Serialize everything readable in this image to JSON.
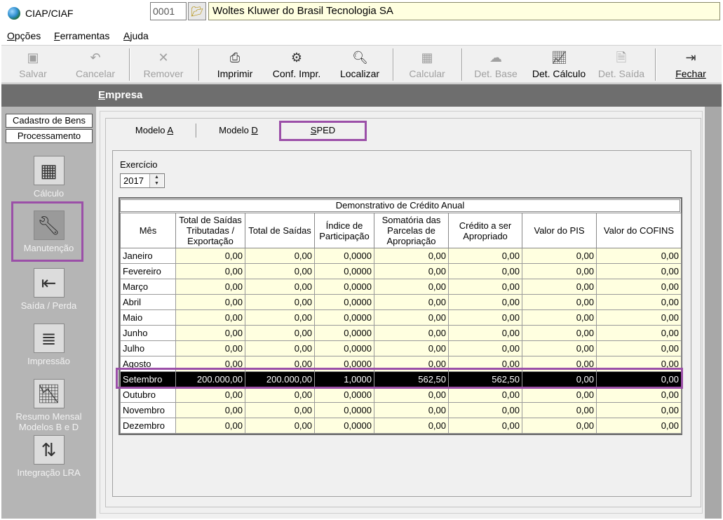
{
  "window": {
    "title": "CIAP/CIAF",
    "minimize": "—",
    "close": "✕"
  },
  "menu": [
    "Opções",
    "Ferramentas",
    "Ajuda"
  ],
  "toolbar": {
    "salvar": "Salvar",
    "cancelar": "Cancelar",
    "remover": "Remover",
    "imprimir": "Imprimir",
    "conf_impr": "Conf. Impr.",
    "localizar": "Localizar",
    "calcular": "Calcular",
    "det_base": "Det. Base",
    "det_calculo": "Det. Cálculo",
    "det_saida": "Det. Saída",
    "fechar": "Fechar"
  },
  "empresa": {
    "label": "Empresa",
    "code": "0001",
    "name": "Woltes Kluwer do Brasil Tecnologia SA"
  },
  "left": {
    "tab1": "Cadastro de Bens",
    "tab2": "Processamento",
    "items": [
      "Cálculo",
      "Manutenção",
      "Saída / Perda",
      "Impressão",
      "Resumo Mensal Modelos B e D",
      "Integração LRA"
    ]
  },
  "tabs": {
    "a_prefix": "Modelo ",
    "a_key": "A",
    "d_prefix": "Modelo ",
    "d_key": "D",
    "sped_key": "S",
    "sped_rest": "PED"
  },
  "exercicio": {
    "label": "Exercício",
    "value": "2017"
  },
  "table": {
    "title": "Demonstrativo de Crédito Anual",
    "headers": [
      "Mês",
      "Total de Saídas Tributadas / Exportação",
      "Total de Saídas",
      "Índice de Participação",
      "Somatória das Parcelas de Apropriação",
      "Crédito a ser Apropriado",
      "Valor do PIS",
      "Valor do COFINS"
    ],
    "rows": [
      [
        "Janeiro",
        "0,00",
        "0,00",
        "0,0000",
        "0,00",
        "0,00",
        "0,00",
        "0,00"
      ],
      [
        "Fevereiro",
        "0,00",
        "0,00",
        "0,0000",
        "0,00",
        "0,00",
        "0,00",
        "0,00"
      ],
      [
        "Março",
        "0,00",
        "0,00",
        "0,0000",
        "0,00",
        "0,00",
        "0,00",
        "0,00"
      ],
      [
        "Abril",
        "0,00",
        "0,00",
        "0,0000",
        "0,00",
        "0,00",
        "0,00",
        "0,00"
      ],
      [
        "Maio",
        "0,00",
        "0,00",
        "0,0000",
        "0,00",
        "0,00",
        "0,00",
        "0,00"
      ],
      [
        "Junho",
        "0,00",
        "0,00",
        "0,0000",
        "0,00",
        "0,00",
        "0,00",
        "0,00"
      ],
      [
        "Julho",
        "0,00",
        "0,00",
        "0,0000",
        "0,00",
        "0,00",
        "0,00",
        "0,00"
      ],
      [
        "Agosto",
        "0,00",
        "0,00",
        "0,0000",
        "0,00",
        "0,00",
        "0,00",
        "0,00"
      ],
      [
        "Setembro",
        "200.000,00",
        "200.000,00",
        "1,0000",
        "562,50",
        "562,50",
        "0,00",
        "0,00"
      ],
      [
        "Outubro",
        "0,00",
        "0,00",
        "0,0000",
        "0,00",
        "0,00",
        "0,00",
        "0,00"
      ],
      [
        "Novembro",
        "0,00",
        "0,00",
        "0,0000",
        "0,00",
        "0,00",
        "0,00",
        "0,00"
      ],
      [
        "Dezembro",
        "0,00",
        "0,00",
        "0,0000",
        "0,00",
        "0,00",
        "0,00",
        "0,00"
      ]
    ],
    "selected_row": "Setembro"
  },
  "colors": {
    "highlight": "#9b4fa8",
    "field_bg": "#ffffe0",
    "panel_gray": "#b5b5b5",
    "bar_gray": "#6e6e6e"
  },
  "icons": {
    "salvar": "save-icon",
    "cancelar": "undo-icon",
    "remover": "x-icon",
    "imprimir": "printer-icon",
    "conf_impr": "printer-config-icon",
    "localizar": "search-document-icon",
    "calcular": "calculator-icon",
    "det_base": "base-icon",
    "det_calculo": "chart-icon",
    "det_saida": "document-arrow-icon",
    "fechar": "exit-door-icon"
  }
}
